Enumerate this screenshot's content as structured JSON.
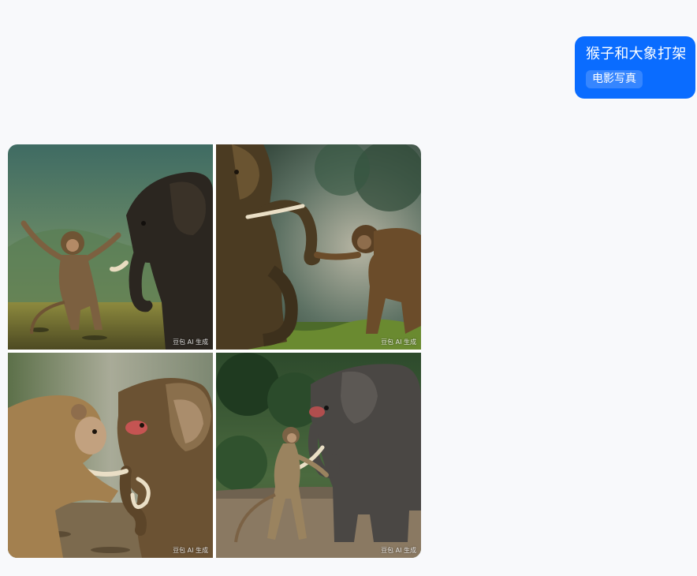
{
  "user_message": {
    "prompt": "猴子和大象打架",
    "style_tag": "电影写真"
  },
  "generated_images": [
    {
      "alt": "猴子和大象打架 1",
      "watermark": "豆包 AI 生成"
    },
    {
      "alt": "猴子和大象打架 2",
      "watermark": "豆包 AI 生成"
    },
    {
      "alt": "猴子和大象打架 3",
      "watermark": "豆包 AI 生成"
    },
    {
      "alt": "猴子和大象打架 4",
      "watermark": "豆包 AI 生成"
    }
  ],
  "colors": {
    "bubble_bg": "#0a6cff",
    "page_bg": "#f8f9fb"
  }
}
